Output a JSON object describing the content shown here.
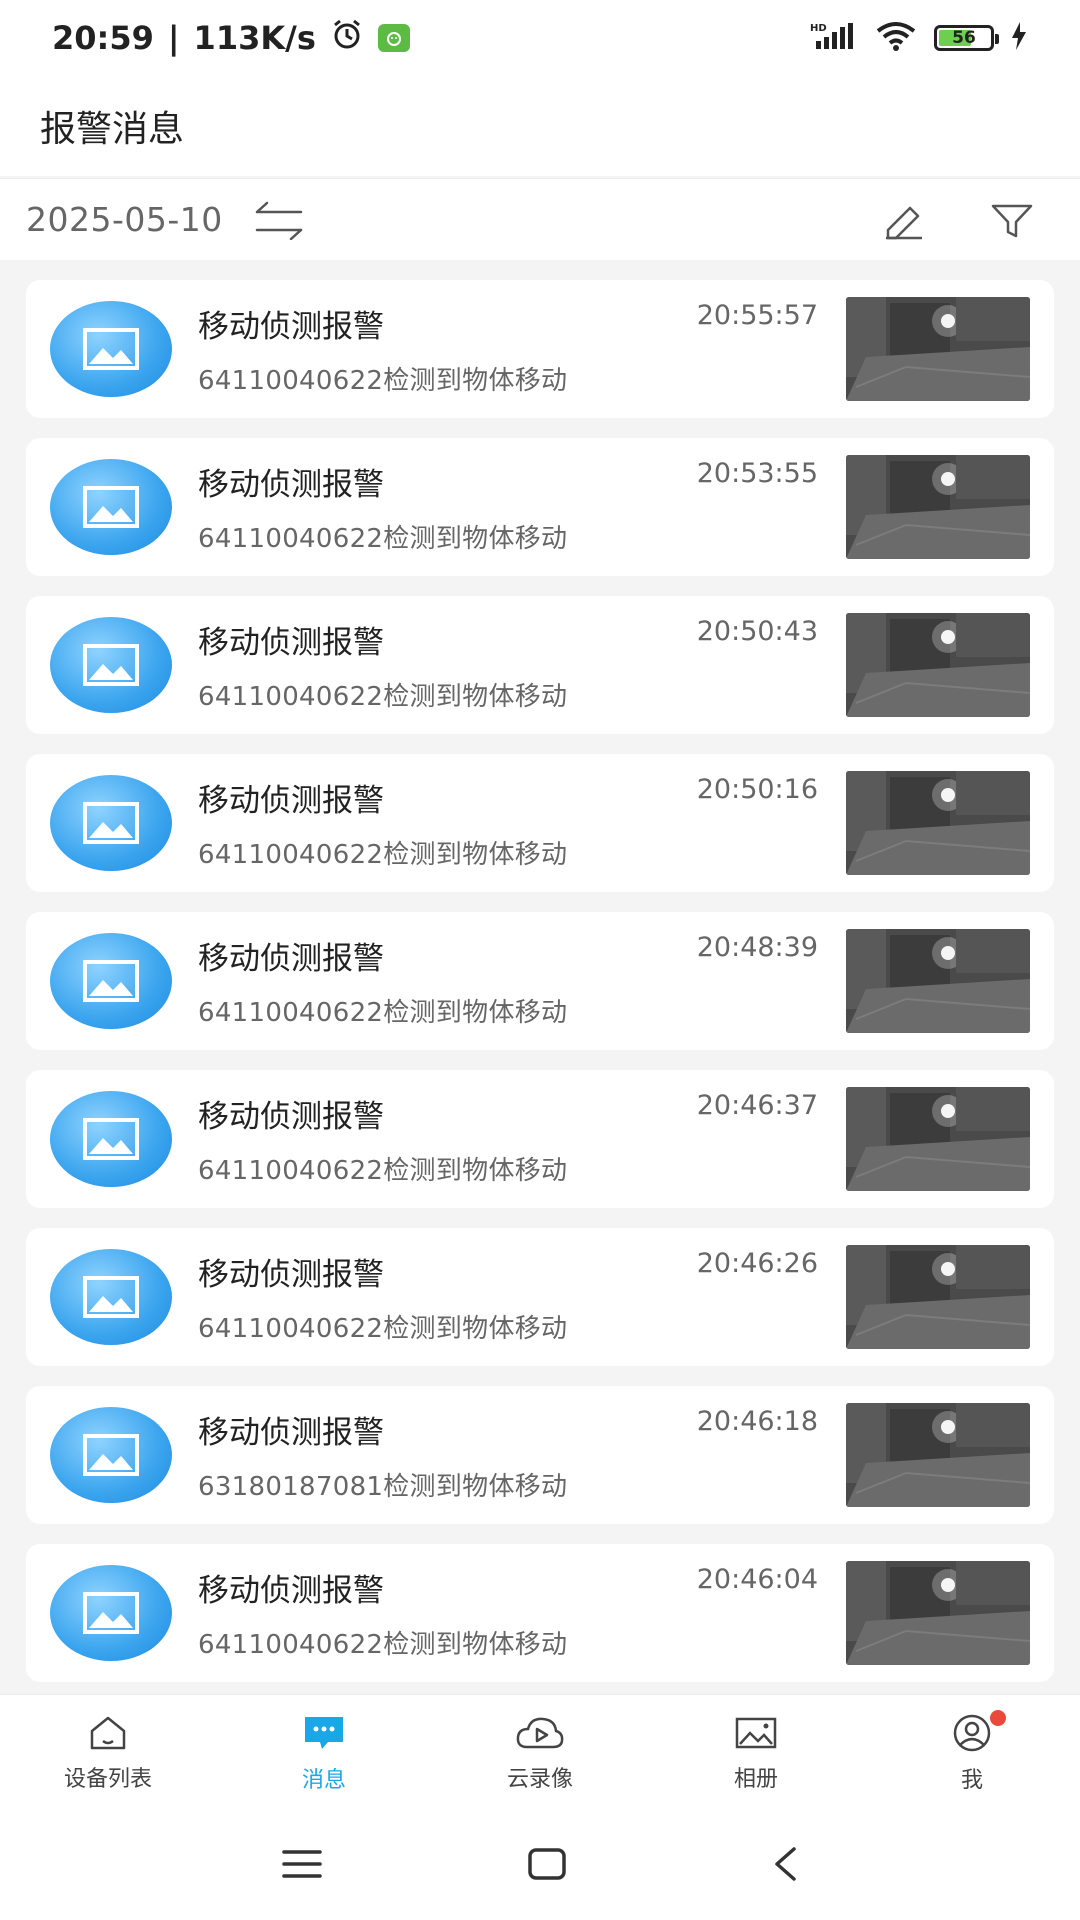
{
  "status_bar": {
    "time": "20:59",
    "separator": "|",
    "speed": "113K/s",
    "battery": "56"
  },
  "header": {
    "title": "报警消息"
  },
  "filter": {
    "date": "2025-05-10"
  },
  "alarms": [
    {
      "title": "移动侦测报警",
      "desc": "64110040622检测到物体移动",
      "time": "20:55:57"
    },
    {
      "title": "移动侦测报警",
      "desc": "64110040622检测到物体移动",
      "time": "20:53:55"
    },
    {
      "title": "移动侦测报警",
      "desc": "64110040622检测到物体移动",
      "time": "20:50:43"
    },
    {
      "title": "移动侦测报警",
      "desc": "64110040622检测到物体移动",
      "time": "20:50:16"
    },
    {
      "title": "移动侦测报警",
      "desc": "64110040622检测到物体移动",
      "time": "20:48:39"
    },
    {
      "title": "移动侦测报警",
      "desc": "64110040622检测到物体移动",
      "time": "20:46:37"
    },
    {
      "title": "移动侦测报警",
      "desc": "64110040622检测到物体移动",
      "time": "20:46:26"
    },
    {
      "title": "移动侦测报警",
      "desc": "63180187081检测到物体移动",
      "time": "20:46:18"
    },
    {
      "title": "移动侦测报警",
      "desc": "64110040622检测到物体移动",
      "time": "20:46:04"
    }
  ],
  "bottom_nav": {
    "items": [
      {
        "label": "设备列表",
        "icon": "home-icon"
      },
      {
        "label": "消息",
        "icon": "message-icon",
        "active": true
      },
      {
        "label": "云录像",
        "icon": "cloud-video-icon"
      },
      {
        "label": "相册",
        "icon": "album-icon"
      },
      {
        "label": "我",
        "icon": "profile-icon",
        "badge": true
      }
    ]
  },
  "colors": {
    "accent": "#1aa7e8",
    "badge": "#e84b3c",
    "icon_blue": "#3aa4ee"
  }
}
